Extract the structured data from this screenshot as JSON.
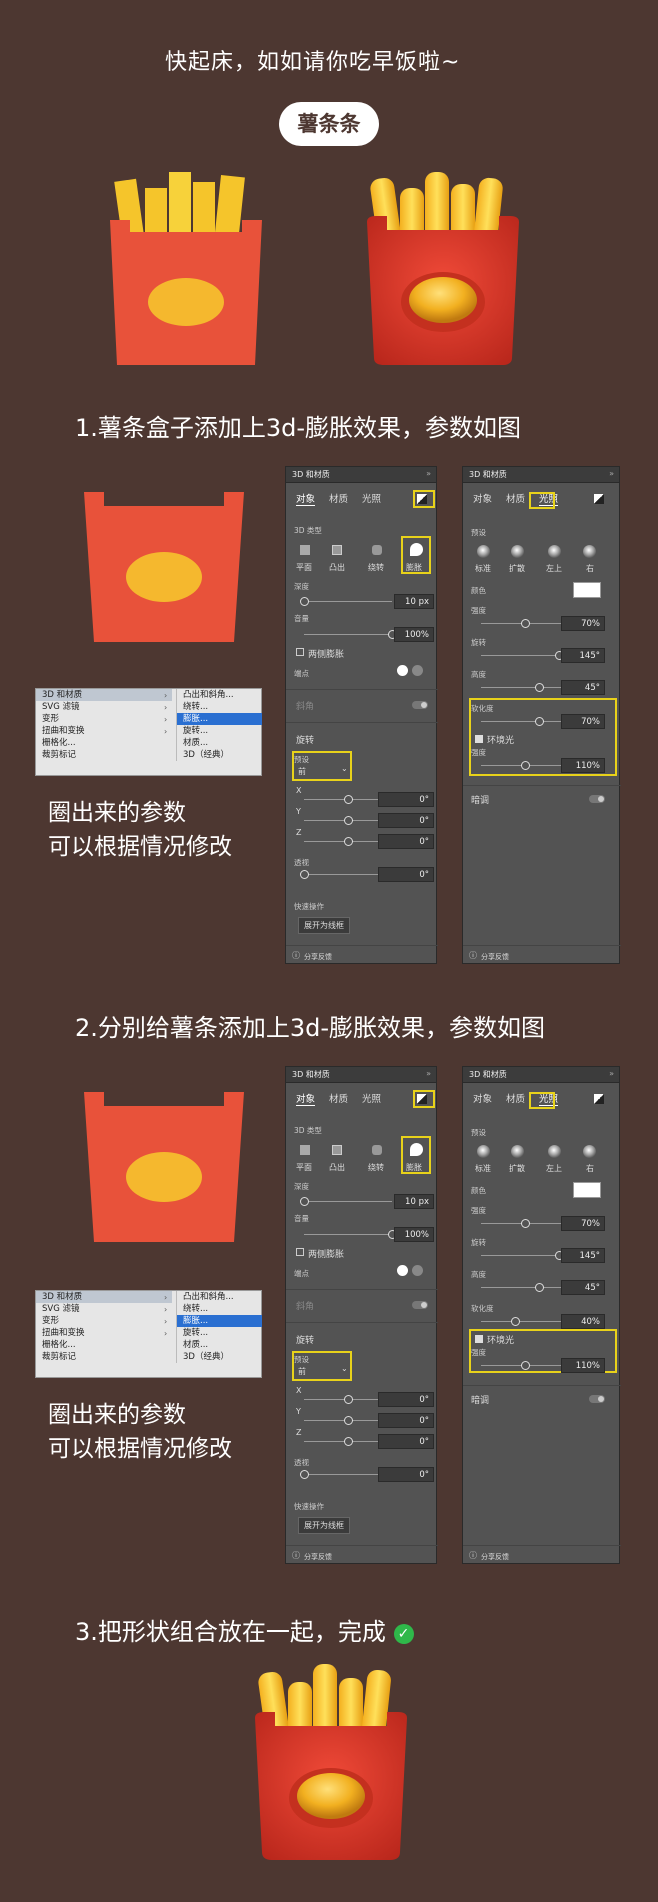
{
  "header": {
    "title": "快起床，如如请你吃早饭啦~",
    "badge": "薯条条"
  },
  "steps": [
    {
      "label": "1.薯条盒子添加上3d-膨胀效果，参数如图"
    },
    {
      "label": "2.分别给薯条添加上3d-膨胀效果，参数如图"
    },
    {
      "label": "3.把形状组合放在一起，完成"
    }
  ],
  "note": {
    "line1": "圈出来的参数",
    "line2": "可以根据情况修改"
  },
  "menu": {
    "left": [
      "3D 和材质",
      "SVG 滤镜",
      "变形",
      "扭曲和变换",
      "栅格化...",
      "裁剪标记"
    ],
    "right": [
      "凸出和斜角...",
      "绕转...",
      "膨胀...",
      "旋转...",
      "材质...",
      "3D（经典）"
    ]
  },
  "panel_object": {
    "title": "3D 和材质",
    "tabs": [
      "对象",
      "材质",
      "光照"
    ],
    "type_label": "3D 类型",
    "types": [
      "平面",
      "凸出",
      "绕转",
      "膨胀"
    ],
    "depth_label": "深度",
    "depth": "10 px",
    "volume_label": "音量",
    "volume": "100%",
    "both_sides": "两侧膨胀",
    "cap_label": "端点",
    "bevel": "斜角",
    "rotate": "旋转",
    "preset_label": "预设",
    "preset": "前",
    "axes": [
      "X",
      "Y",
      "Z"
    ],
    "axis_val": "0°",
    "persp_label": "透视",
    "persp": "0°",
    "quick": "快速操作",
    "expand": "展开为线框",
    "feedback": "分享反馈"
  },
  "panel_light_1": {
    "title": "3D 和材质",
    "tabs": [
      "对象",
      "材质",
      "光照"
    ],
    "preset_label": "预设",
    "lights": [
      "标准",
      "扩散",
      "左上",
      "右"
    ],
    "color_label": "颜色",
    "intensity_label": "强度",
    "intensity": "70%",
    "rotate_label": "旋转",
    "rotate": "145°",
    "height_label": "高度",
    "height": "45°",
    "soft_label": "软化度",
    "soft": "70%",
    "ambient": "环境光",
    "amb_int_label": "强度",
    "amb_int": "110%",
    "shadow": "暗调",
    "feedback": "分享反馈"
  },
  "panel_light_2": {
    "soft": "40%"
  },
  "colors": {
    "bg": "#4d3731",
    "box": "#e8523a",
    "oval": "#f5b82e",
    "highlight": "#e8d21a"
  }
}
